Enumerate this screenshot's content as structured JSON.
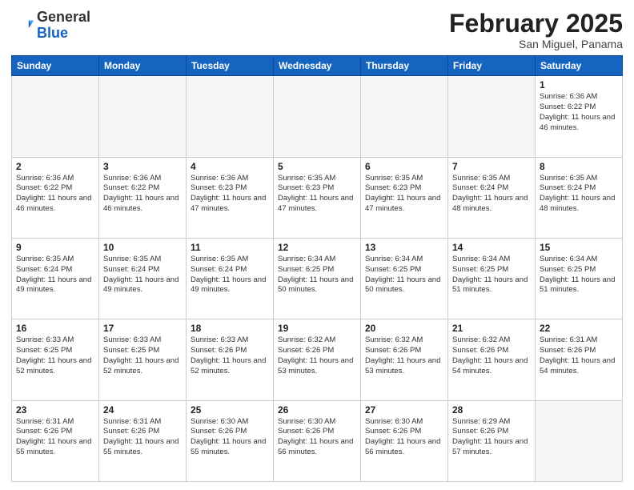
{
  "header": {
    "logo_general": "General",
    "logo_blue": "Blue",
    "month_title": "February 2025",
    "location": "San Miguel, Panama"
  },
  "days_of_week": [
    "Sunday",
    "Monday",
    "Tuesday",
    "Wednesday",
    "Thursday",
    "Friday",
    "Saturday"
  ],
  "weeks": [
    [
      {
        "day": "",
        "info": ""
      },
      {
        "day": "",
        "info": ""
      },
      {
        "day": "",
        "info": ""
      },
      {
        "day": "",
        "info": ""
      },
      {
        "day": "",
        "info": ""
      },
      {
        "day": "",
        "info": ""
      },
      {
        "day": "1",
        "info": "Sunrise: 6:36 AM\nSunset: 6:22 PM\nDaylight: 11 hours and 46 minutes."
      }
    ],
    [
      {
        "day": "2",
        "info": "Sunrise: 6:36 AM\nSunset: 6:22 PM\nDaylight: 11 hours and 46 minutes."
      },
      {
        "day": "3",
        "info": "Sunrise: 6:36 AM\nSunset: 6:22 PM\nDaylight: 11 hours and 46 minutes."
      },
      {
        "day": "4",
        "info": "Sunrise: 6:36 AM\nSunset: 6:23 PM\nDaylight: 11 hours and 47 minutes."
      },
      {
        "day": "5",
        "info": "Sunrise: 6:35 AM\nSunset: 6:23 PM\nDaylight: 11 hours and 47 minutes."
      },
      {
        "day": "6",
        "info": "Sunrise: 6:35 AM\nSunset: 6:23 PM\nDaylight: 11 hours and 47 minutes."
      },
      {
        "day": "7",
        "info": "Sunrise: 6:35 AM\nSunset: 6:24 PM\nDaylight: 11 hours and 48 minutes."
      },
      {
        "day": "8",
        "info": "Sunrise: 6:35 AM\nSunset: 6:24 PM\nDaylight: 11 hours and 48 minutes."
      }
    ],
    [
      {
        "day": "9",
        "info": "Sunrise: 6:35 AM\nSunset: 6:24 PM\nDaylight: 11 hours and 49 minutes."
      },
      {
        "day": "10",
        "info": "Sunrise: 6:35 AM\nSunset: 6:24 PM\nDaylight: 11 hours and 49 minutes."
      },
      {
        "day": "11",
        "info": "Sunrise: 6:35 AM\nSunset: 6:24 PM\nDaylight: 11 hours and 49 minutes."
      },
      {
        "day": "12",
        "info": "Sunrise: 6:34 AM\nSunset: 6:25 PM\nDaylight: 11 hours and 50 minutes."
      },
      {
        "day": "13",
        "info": "Sunrise: 6:34 AM\nSunset: 6:25 PM\nDaylight: 11 hours and 50 minutes."
      },
      {
        "day": "14",
        "info": "Sunrise: 6:34 AM\nSunset: 6:25 PM\nDaylight: 11 hours and 51 minutes."
      },
      {
        "day": "15",
        "info": "Sunrise: 6:34 AM\nSunset: 6:25 PM\nDaylight: 11 hours and 51 minutes."
      }
    ],
    [
      {
        "day": "16",
        "info": "Sunrise: 6:33 AM\nSunset: 6:25 PM\nDaylight: 11 hours and 52 minutes."
      },
      {
        "day": "17",
        "info": "Sunrise: 6:33 AM\nSunset: 6:25 PM\nDaylight: 11 hours and 52 minutes."
      },
      {
        "day": "18",
        "info": "Sunrise: 6:33 AM\nSunset: 6:26 PM\nDaylight: 11 hours and 52 minutes."
      },
      {
        "day": "19",
        "info": "Sunrise: 6:32 AM\nSunset: 6:26 PM\nDaylight: 11 hours and 53 minutes."
      },
      {
        "day": "20",
        "info": "Sunrise: 6:32 AM\nSunset: 6:26 PM\nDaylight: 11 hours and 53 minutes."
      },
      {
        "day": "21",
        "info": "Sunrise: 6:32 AM\nSunset: 6:26 PM\nDaylight: 11 hours and 54 minutes."
      },
      {
        "day": "22",
        "info": "Sunrise: 6:31 AM\nSunset: 6:26 PM\nDaylight: 11 hours and 54 minutes."
      }
    ],
    [
      {
        "day": "23",
        "info": "Sunrise: 6:31 AM\nSunset: 6:26 PM\nDaylight: 11 hours and 55 minutes."
      },
      {
        "day": "24",
        "info": "Sunrise: 6:31 AM\nSunset: 6:26 PM\nDaylight: 11 hours and 55 minutes."
      },
      {
        "day": "25",
        "info": "Sunrise: 6:30 AM\nSunset: 6:26 PM\nDaylight: 11 hours and 55 minutes."
      },
      {
        "day": "26",
        "info": "Sunrise: 6:30 AM\nSunset: 6:26 PM\nDaylight: 11 hours and 56 minutes."
      },
      {
        "day": "27",
        "info": "Sunrise: 6:30 AM\nSunset: 6:26 PM\nDaylight: 11 hours and 56 minutes."
      },
      {
        "day": "28",
        "info": "Sunrise: 6:29 AM\nSunset: 6:26 PM\nDaylight: 11 hours and 57 minutes."
      },
      {
        "day": "",
        "info": ""
      }
    ]
  ]
}
